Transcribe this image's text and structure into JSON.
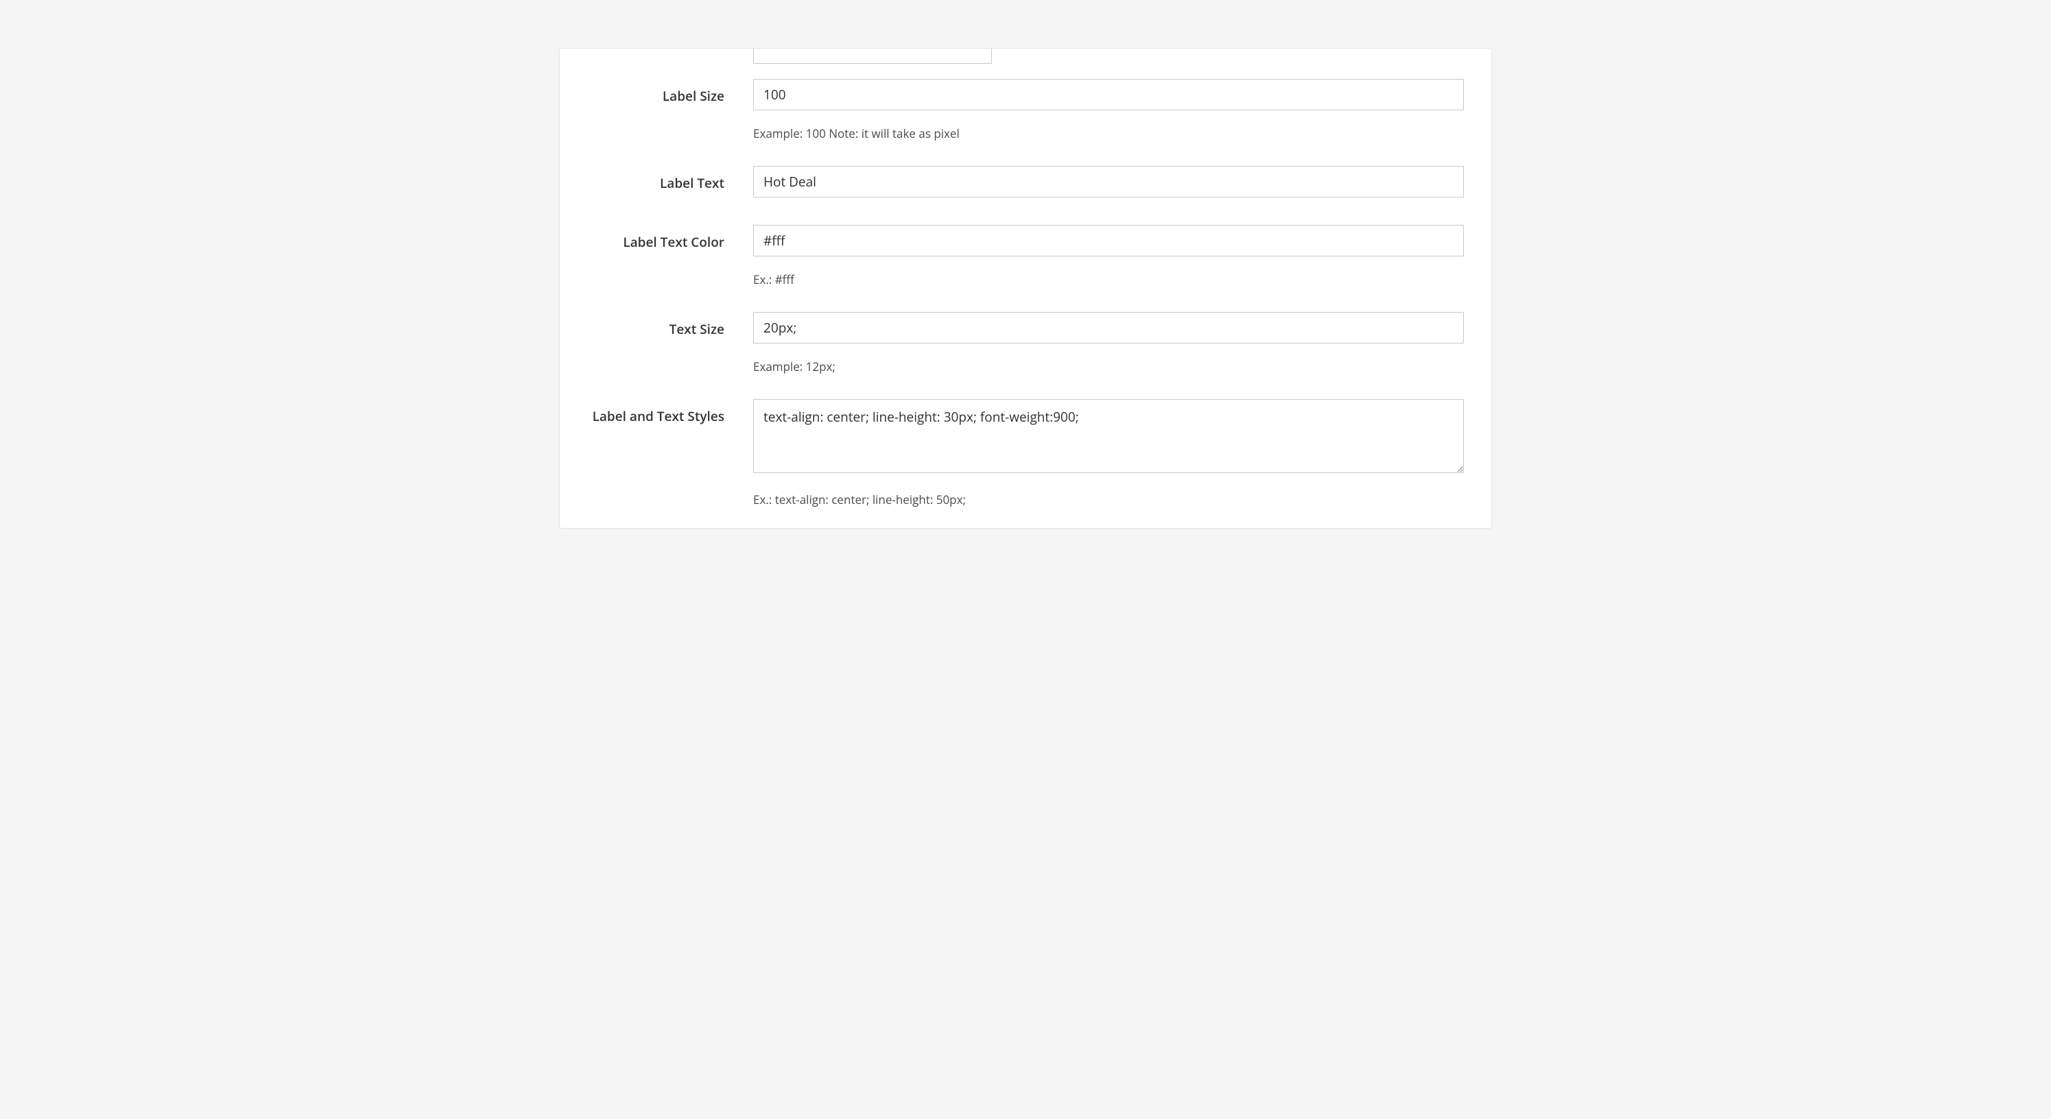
{
  "form": {
    "labelSize": {
      "label": "Label Size",
      "value": "100",
      "hint": "Example: 100 Note: it will take as pixel"
    },
    "labelText": {
      "label": "Label Text",
      "value": "Hot Deal"
    },
    "labelTextColor": {
      "label": "Label Text Color",
      "value": "#fff",
      "hint": "Ex.: #fff"
    },
    "textSize": {
      "label": "Text Size",
      "value": "20px;",
      "hint": "Example: 12px;"
    },
    "labelAndTextStyles": {
      "label": "Label and Text Styles",
      "value": "text-align: center; line-height: 30px; font-weight:900;",
      "hint": "Ex.: text-align: center; line-height: 50px;"
    }
  }
}
